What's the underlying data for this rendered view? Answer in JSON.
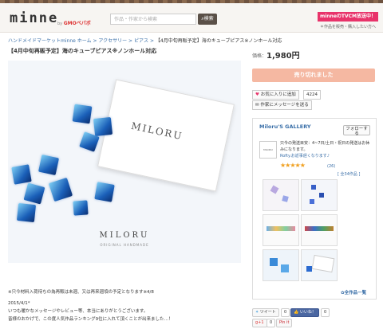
{
  "header": {
    "logo": "minne",
    "logo_by": "by",
    "logo_company": "GMOペパボ",
    "search_placeholder": "作品・作家から検索",
    "search_button": "検索",
    "tvcm_banner": "minneのTVCM放送中！",
    "tvcm_sub": "＊作品を販売・購入したい方へ"
  },
  "breadcrumb": {
    "items": [
      "ハンドメイドマーケットminne ホーム",
      "アクセサリー",
      "ピアス"
    ],
    "separator": ">",
    "current": "【4月中旬再販予定】海のキューブピアス※ノンホール対応"
  },
  "product": {
    "title": "【4月中旬再販予定】海のキューブピアス※ノンホール対応",
    "image_brand": "MILORU",
    "image_brand_sub": "ORIGINAL HANDMADE",
    "card_text": "MILORU",
    "description": [
      "※只今材料入荷待ちの為再販は未週、又は再来週頃の予定となります※4/8",
      "",
      "2015/4/1*",
      "いつも暖かなメッセージやレビュー等、本当にありがとうございます。",
      "皆様のおかげで、この度人気作品ランキング9位に入れて頂くことが出来ました…！"
    ]
  },
  "purchase": {
    "price_label": "価格：",
    "price": "1,980円",
    "sold_out": "売り切れました",
    "favorite_label": "お気に入りに追加",
    "favorite_count": "4224",
    "message_label": "作家にメッセージを送る"
  },
  "shop": {
    "name": "Miloru'S GALLERY",
    "follow": "フォローする",
    "logo_text": "MILORU",
    "notice": "只今の発送目安：4~7日/土日・祝日の発送はお休みになります。",
    "notice_link": "Rofty.お返事遅くなります♪",
    "stars": "★★★★★",
    "rating_count": "(26)",
    "all_items": "[ 全34作品 ]",
    "all_list": "✿全作品一覧"
  },
  "social": {
    "tweet": "ツイート",
    "tweet_count": "0",
    "like": "いいね！",
    "like_count": "0",
    "gplus": "g+1",
    "gplus_count": "0",
    "pin": "Pin it"
  },
  "colors": {
    "accent_pink": "#e8336a",
    "sold_out": "#f5b8a2",
    "link": "#3a6fa8",
    "star": "#f0a020"
  }
}
